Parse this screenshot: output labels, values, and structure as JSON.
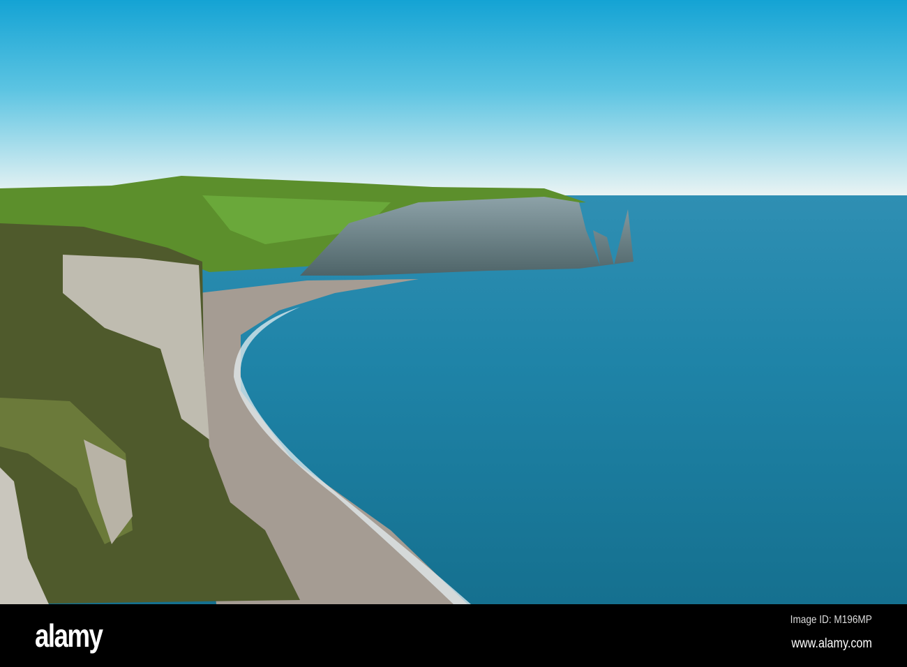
{
  "photo": {
    "subject": "Chalk cliffs, arch and needle above a pebble beach and blue sea"
  },
  "watermark": {
    "brand": "alamy",
    "image_id": "Image ID: M196MP",
    "url": "www.alamy.com"
  },
  "colors": {
    "sky_top": "#1aa6d6",
    "sky_horizon": "#eaf4f6",
    "sea": "#1b7fa3",
    "grass": "#5a8a2a",
    "beach": "#a49a92"
  }
}
